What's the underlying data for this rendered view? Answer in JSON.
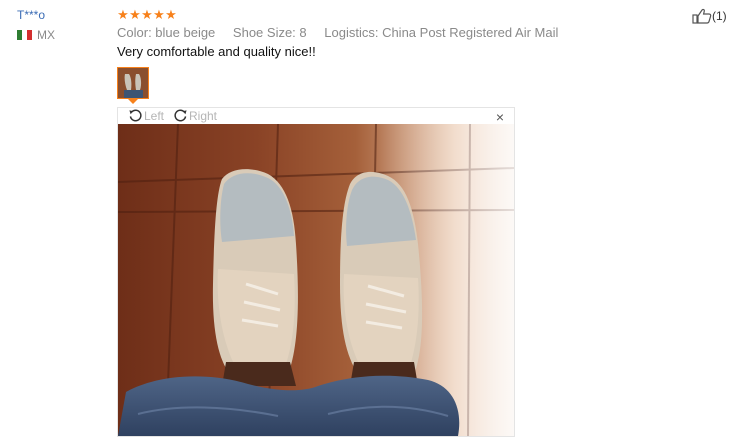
{
  "review": {
    "user_name": "T***o",
    "country": "MX",
    "rating": 5,
    "attributes": [
      "Color: blue beige",
      "Shoe Size: 8",
      "Logistics: China Post Registered Air Mail"
    ],
    "text": "Very comfortable and quality nice!!",
    "helpful_count": "(1)"
  },
  "viewer": {
    "rotate_left_label": "Left",
    "rotate_right_label": "Right",
    "close_label": "×"
  },
  "colors": {
    "accent": "#f7811b",
    "link": "#3b6cb5",
    "muted": "#8a8a8a"
  }
}
